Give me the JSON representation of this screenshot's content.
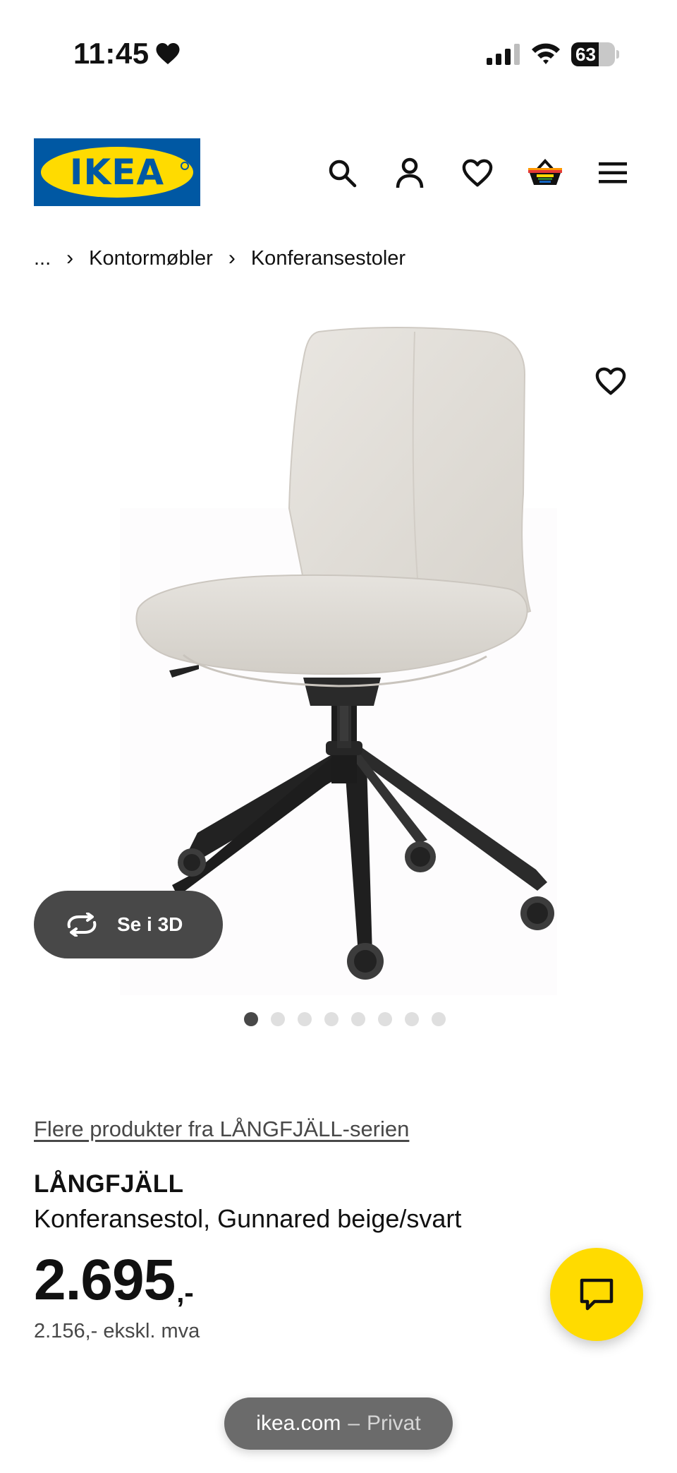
{
  "status_bar": {
    "time": "11:45",
    "battery": "63",
    "battery_level": 0.63
  },
  "header": {
    "logo_text": "IKEA"
  },
  "breadcrumb": {
    "ellipsis": "...",
    "separator": "›",
    "items": [
      "Kontormøbler",
      "Konferansestoler"
    ]
  },
  "gallery": {
    "see_3d_label": "Se i 3D",
    "image_count": 8,
    "active_index": 0
  },
  "product": {
    "series_link": "Flere produkter fra LÅNGFJÄLL-serien",
    "name": "LÅNGFJÄLL",
    "description": "Konferansestol, Gunnared beige/svart",
    "price": "2.695",
    "price_suffix": ",-",
    "price_excl_vat": "2.156,- ekskl. mva"
  },
  "browser": {
    "domain": "ikea.com",
    "separator": "–",
    "mode": "Privat"
  },
  "colors": {
    "ikea_blue": "#0058a3",
    "ikea_yellow": "#ffdb00",
    "dark_grey": "#484848"
  }
}
